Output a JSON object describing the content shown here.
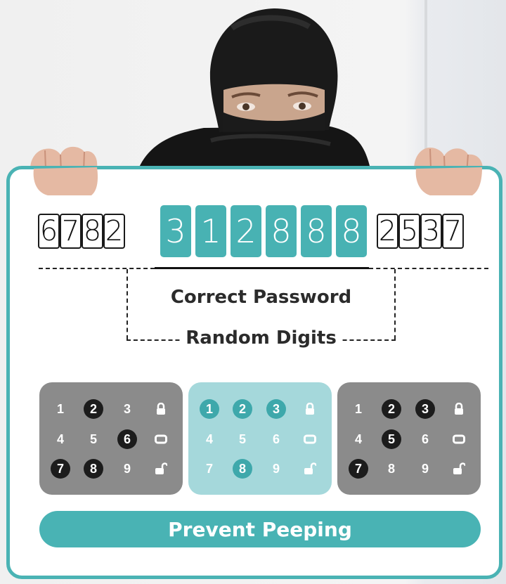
{
  "password_strip": {
    "left_digits": [
      "6",
      "7",
      "8",
      "2"
    ],
    "highlighted_digits": [
      "3",
      "1",
      "2",
      "8",
      "8",
      "8"
    ],
    "right_digits": [
      "2",
      "5",
      "3",
      "7"
    ]
  },
  "labels": {
    "correct_password": "Correct Password",
    "random_digits": "Random Digits"
  },
  "keypads": [
    {
      "style": "grey",
      "rows": [
        [
          {
            "v": "1",
            "on": false
          },
          {
            "v": "2",
            "on": true
          },
          {
            "v": "3",
            "on": false
          },
          {
            "icon": "lock-closed-icon"
          }
        ],
        [
          {
            "v": "4",
            "on": false
          },
          {
            "v": "5",
            "on": false
          },
          {
            "v": "6",
            "on": true
          },
          {
            "icon": "rounded-rect-icon"
          }
        ],
        [
          {
            "v": "7",
            "on": true
          },
          {
            "v": "8",
            "on": true
          },
          {
            "v": "9",
            "on": false
          },
          {
            "icon": "lock-open-icon"
          }
        ]
      ]
    },
    {
      "style": "teal",
      "rows": [
        [
          {
            "v": "1",
            "on": true
          },
          {
            "v": "2",
            "on": true
          },
          {
            "v": "3",
            "on": true
          },
          {
            "icon": "lock-closed-icon"
          }
        ],
        [
          {
            "v": "4",
            "on": false
          },
          {
            "v": "5",
            "on": false
          },
          {
            "v": "6",
            "on": false
          },
          {
            "icon": "rounded-rect-icon"
          }
        ],
        [
          {
            "v": "7",
            "on": false
          },
          {
            "v": "8",
            "on": true
          },
          {
            "v": "9",
            "on": false
          },
          {
            "icon": "lock-open-icon"
          }
        ]
      ]
    },
    {
      "style": "grey",
      "rows": [
        [
          {
            "v": "1",
            "on": false
          },
          {
            "v": "2",
            "on": true
          },
          {
            "v": "3",
            "on": true
          },
          {
            "icon": "lock-closed-icon"
          }
        ],
        [
          {
            "v": "4",
            "on": false
          },
          {
            "v": "5",
            "on": true
          },
          {
            "v": "6",
            "on": false
          },
          {
            "icon": "rounded-rect-icon"
          }
        ],
        [
          {
            "v": "7",
            "on": true
          },
          {
            "v": "8",
            "on": false
          },
          {
            "v": "9",
            "on": false
          },
          {
            "icon": "lock-open-icon"
          }
        ]
      ]
    }
  ],
  "button": {
    "label": "Prevent Peeping"
  },
  "colors": {
    "teal": "#49b3b4",
    "light_teal": "#a5d8db",
    "grey_pad": "#8b8b8b",
    "active_key_dark": "#1c1c1c"
  }
}
